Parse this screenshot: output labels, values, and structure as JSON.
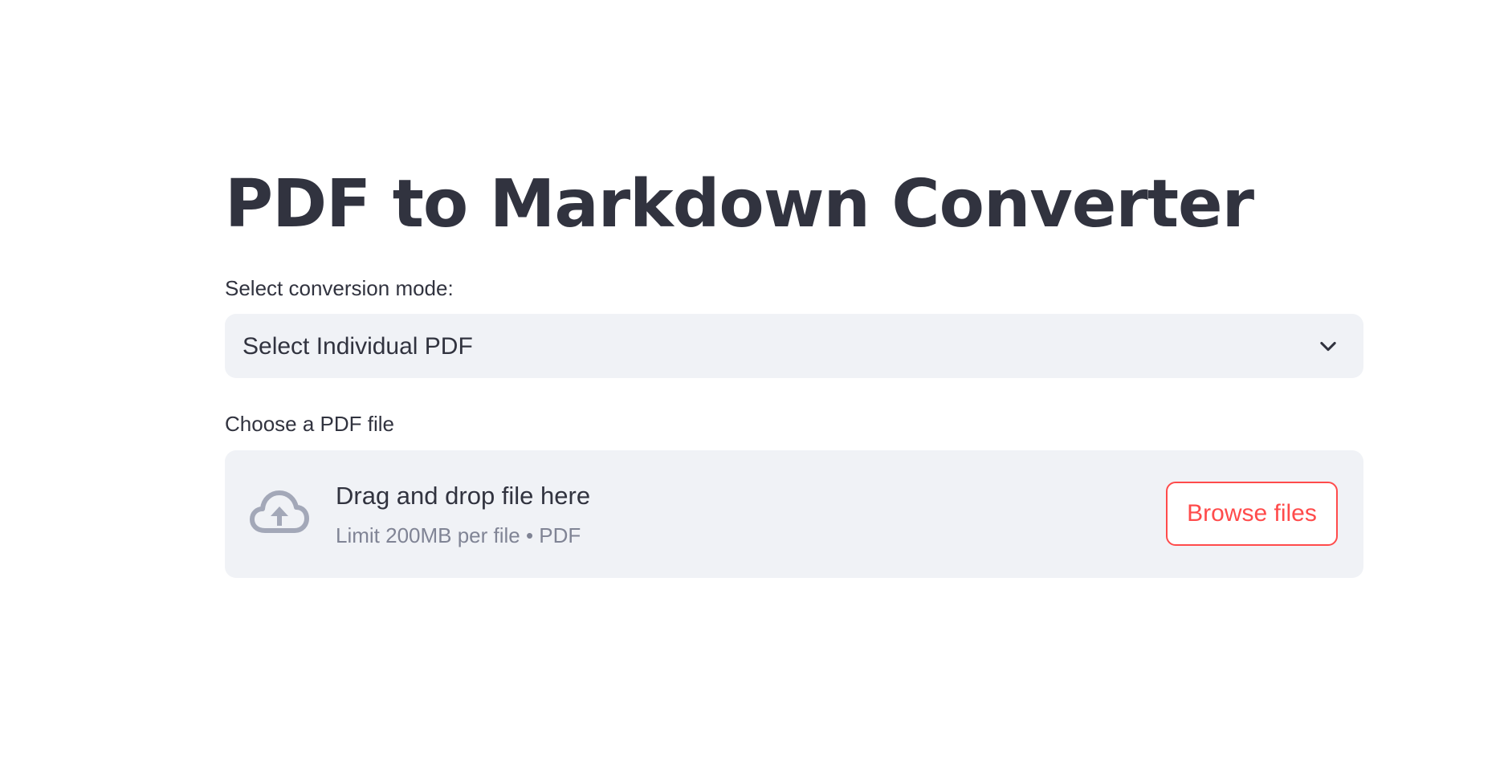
{
  "page": {
    "title": "PDF to Markdown Converter"
  },
  "mode_select": {
    "label": "Select conversion mode:",
    "value": "Select Individual PDF",
    "icon": "chevron-down-icon"
  },
  "file_uploader": {
    "label": "Choose a PDF file",
    "drop_text": "Drag and drop file here",
    "limit_text": "Limit 200MB per file • PDF",
    "icon": "cloud-upload-icon",
    "button_label": "Browse files"
  },
  "colors": {
    "text": "#31333f",
    "muted": "#808495",
    "input_bg": "#f0f2f6",
    "accent": "#ff4b4b",
    "icon": "#a3a8b8"
  }
}
